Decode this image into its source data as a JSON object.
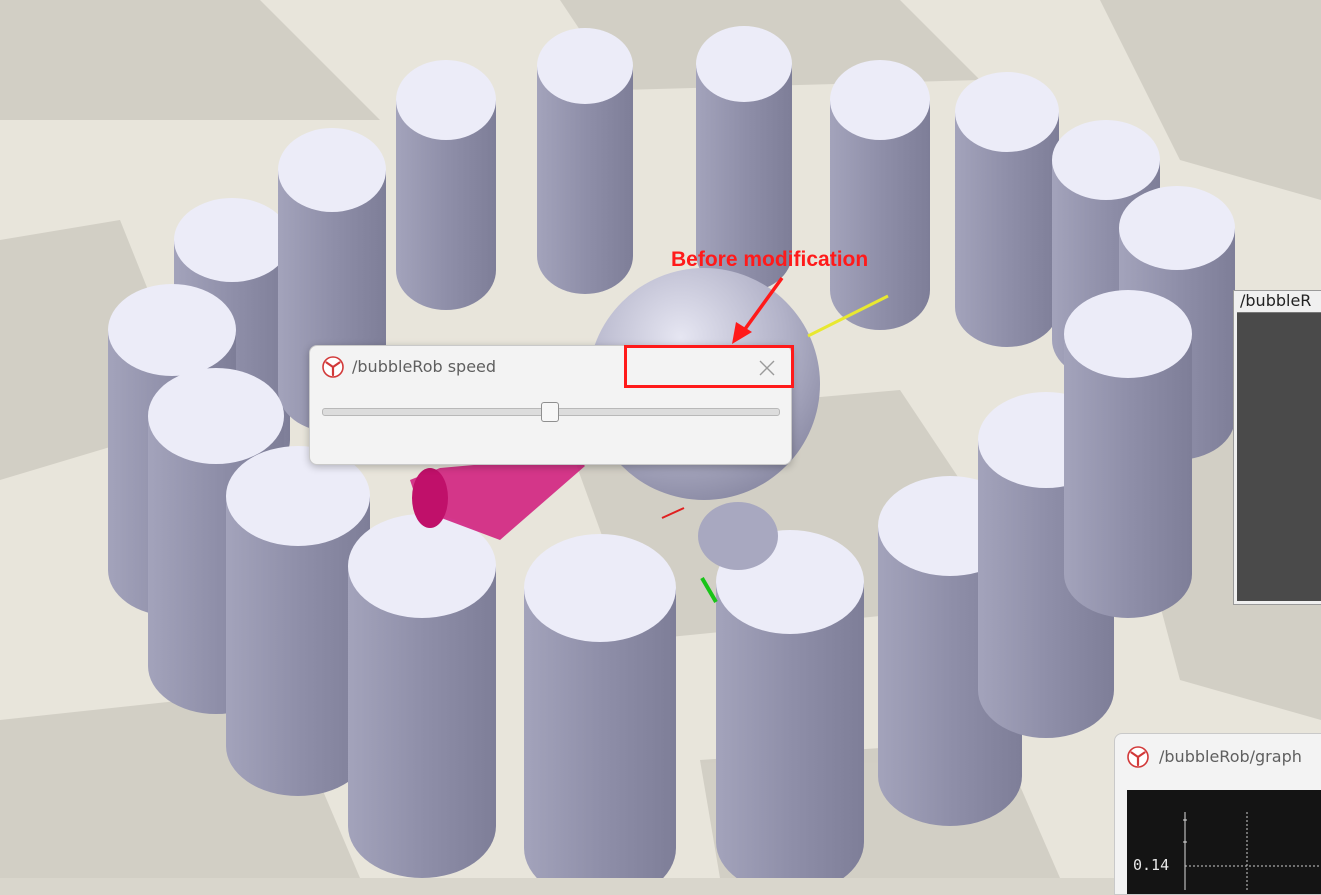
{
  "scene": {
    "description_free": true,
    "cylinder_color": "#8e8ea8",
    "cylinder_top_color": "#ececf8",
    "sphere_color": "#b4b4cc",
    "floor_light": "#e9e6dc",
    "floor_dark": "#c9c6bc"
  },
  "speed_dialog": {
    "title": "/bubbleRob speed",
    "icon": "app-logo-icon",
    "close_icon": "close-icon",
    "slider_value_fraction": 0.5
  },
  "annotation": {
    "label": "Before modification",
    "color": "#ff1a1a"
  },
  "side_window": {
    "title": "/bubbleR"
  },
  "graph_window": {
    "title": "/bubbleRob/graph",
    "icon": "app-logo-icon",
    "y_tick_label": "0.14"
  }
}
